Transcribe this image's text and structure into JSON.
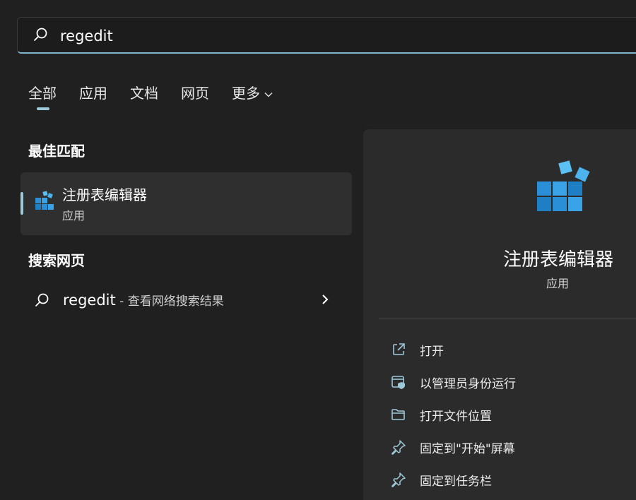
{
  "search": {
    "query": "regedit"
  },
  "tabs": [
    {
      "label": "全部",
      "active": true
    },
    {
      "label": "应用"
    },
    {
      "label": "文档"
    },
    {
      "label": "网页"
    },
    {
      "label": "更多"
    }
  ],
  "best_match": {
    "heading": "最佳匹配",
    "title": "注册表编辑器",
    "subtitle": "应用"
  },
  "web_search": {
    "heading": "搜索网页",
    "query": "regedit",
    "hint": " - 查看网络搜索结果"
  },
  "details": {
    "title": "注册表编辑器",
    "subtitle": "应用",
    "actions": [
      {
        "label": "打开",
        "icon": "open-external-icon"
      },
      {
        "label": "以管理员身份运行",
        "icon": "run-as-admin-icon"
      },
      {
        "label": "打开文件位置",
        "icon": "folder-icon"
      },
      {
        "label": "固定到\"开始\"屏幕",
        "icon": "pin-icon"
      },
      {
        "label": "固定到任务栏",
        "icon": "pin-icon"
      }
    ]
  },
  "colors": {
    "accent": "#9ec9d9",
    "background": "#202020",
    "panel": "#2b2b2b"
  }
}
